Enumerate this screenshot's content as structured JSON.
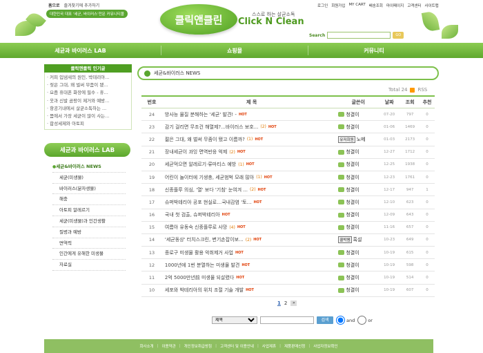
{
  "top": {
    "home": "홈으로",
    "favorite": "즐겨찾기에 추가하기",
    "slogan": "대한민국 대표 '세균, 바이러스'전문 커뮤니티몰",
    "logo_ko": "클릭앤클린",
    "logo_tagline": "스스로 하는 살균소독",
    "logo_en": "Click N Clean",
    "util_links": [
      "로그인",
      "회원가입",
      "MY CART",
      "배송조회",
      "마이페이지",
      "고객센터",
      "사이트맵"
    ],
    "search_label": "Search",
    "search_button": "GO"
  },
  "gnb": [
    "세균과 바이러스 LAB",
    "쇼핑몰",
    "커뮤니티"
  ],
  "popular": {
    "title": "클릭앤클릭 인기글",
    "items": [
      "· 커피 입냄새의 원인, 박테리아...",
      "· 젖은 그대, 왜 벌써 무좀이 됐...",
      "· 요즘 휴대폰 화장에 필수 - 휴...",
      "· 옷과 신발 곰팡이 제거와 예방...",
      "· 항공기내에서 살균소독하는 ...",
      "· 몸에서 가장 세균이 많이 사는...",
      "· 합성세제와 아토피"
    ]
  },
  "lab": {
    "title": "세균과 바이러스 LAB",
    "menu": [
      "세균&바이러스 NEWS",
      "세균(미생물)",
      "바이러스(분자생물)",
      "해충",
      "아토피 알레르기",
      "세균(미생물)과 인간생활",
      "질병과 예방",
      "면역력",
      "인간에게 유해한 미생물",
      "자료실"
    ]
  },
  "board": {
    "title": "세균&바이러스 NEWS",
    "total_label": "Total 24",
    "rss": "RSS",
    "headers": [
      "번호",
      "제 목",
      "글쓴이",
      "날짜",
      "조회",
      "추천"
    ],
    "rows": [
      {
        "no": "24",
        "title": "방사능 물질 분해하는 '세균' 발견! -",
        "cmt": "",
        "writer": "청결이",
        "tag": "",
        "date": "07-20",
        "hit": "797",
        "rec": "0"
      },
      {
        "no": "23",
        "title": "감기 걸리면 무조건 해열제?...바이러스 보호...",
        "cmt": "(2)",
        "writer": "청결이",
        "tag": "",
        "date": "01-06",
        "hit": "1469",
        "rec": "0"
      },
      {
        "no": "22",
        "title": "젊은 그대, 왜 벌써 무좀이 됐고 이름까?",
        "cmt": "(1)",
        "writer": "노떼",
        "tag": "유저회원",
        "date": "01-03",
        "hit": "2173",
        "rec": "0"
      },
      {
        "no": "21",
        "title": "장내세균이 과잉 면역반응 억제",
        "cmt": "(2)",
        "writer": "청결이",
        "tag": "",
        "date": "12-27",
        "hit": "1712",
        "rec": "0"
      },
      {
        "no": "20",
        "title": "세균먹으면 알레르기·류마티스 예방",
        "cmt": "(1)",
        "writer": "청결이",
        "tag": "",
        "date": "12-25",
        "hit": "1938",
        "rec": "0"
      },
      {
        "no": "19",
        "title": "어린이 놀이터에 기생충, 세균범벅 모래 많아",
        "cmt": "(1)",
        "writer": "청결이",
        "tag": "",
        "date": "12-23",
        "hit": "1761",
        "rec": "0"
      },
      {
        "no": "18",
        "title": "신종플루 의심, '열' 보다 '기침' 눈여겨 ...",
        "cmt": "(2)",
        "writer": "청결이",
        "tag": "",
        "date": "12-17",
        "hit": "947",
        "rec": "1"
      },
      {
        "no": "17",
        "title": "슈퍼박테리아 공포 현실로…국내감염 '토…",
        "cmt": "",
        "writer": "청결이",
        "tag": "",
        "date": "12-10",
        "hit": "623",
        "rec": "0"
      },
      {
        "no": "16",
        "title": "국내 첫 검출, 슈퍼박테리아",
        "cmt": "",
        "writer": "청결이",
        "tag": "",
        "date": "12-09",
        "hit": "643",
        "rec": "0"
      },
      {
        "no": "15",
        "title": "여름아 유동숙 신종플루로 사망",
        "cmt": "(4)",
        "writer": "청결이",
        "tag": "",
        "date": "11-16",
        "hit": "657",
        "rec": "0"
      },
      {
        "no": "14",
        "title": "'세균동상' 터치스크린, 변기손잡이보...",
        "cmt": "(2)",
        "writer": "흑설",
        "tag": "쿨박쌤",
        "date": "10-23",
        "hit": "649",
        "rec": "0"
      },
      {
        "no": "13",
        "title": "종로구 미생물 활용 악취제거 사업",
        "cmt": "",
        "writer": "청결이",
        "tag": "",
        "date": "10-19",
        "hit": "615",
        "rec": "0"
      },
      {
        "no": "12",
        "title": "1000년에 1번 분열하는 미생물 발견",
        "cmt": "",
        "writer": "청결이",
        "tag": "",
        "date": "10-19",
        "hit": "598",
        "rec": "0"
      },
      {
        "no": "11",
        "title": "2억 5000만년前 미생물 되살렸다",
        "cmt": "",
        "writer": "청결이",
        "tag": "",
        "date": "10-19",
        "hit": "514",
        "rec": "0"
      },
      {
        "no": "10",
        "title": "세포와 박테리아의 위치 조절 기술 개발",
        "cmt": "",
        "writer": "청결이",
        "tag": "",
        "date": "10-19",
        "hit": "607",
        "rec": "0"
      }
    ],
    "pages": [
      "1",
      "2"
    ],
    "next": "»"
  },
  "bsearch": {
    "field": "제목",
    "button": "검색",
    "and": "and",
    "or": "or"
  },
  "footer": [
    "회사소개",
    "이용약관",
    "개인정보취급방침",
    "고객센터 및 이용안내",
    "사업제휴",
    "제품판매신청",
    "사업자정보확인"
  ]
}
